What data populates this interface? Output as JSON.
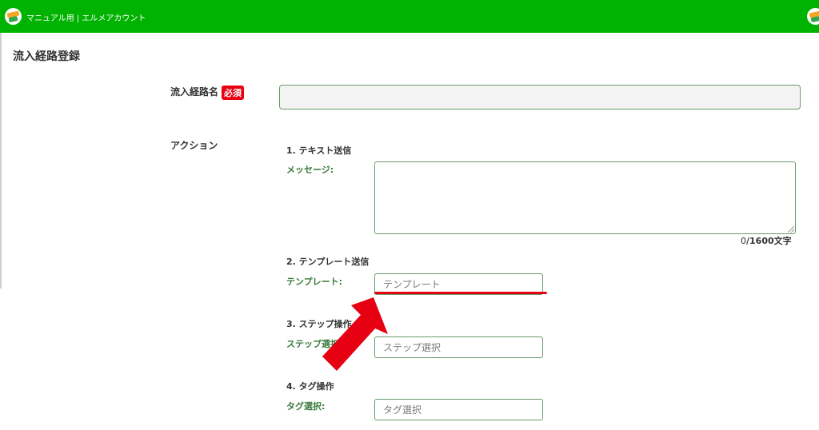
{
  "header": {
    "account_name": "マニュアル用 | エルメアカウント",
    "logo_icon": "lmessage-logo-icon",
    "bar_color": "#00b300"
  },
  "page": {
    "title": "流入経路登録"
  },
  "form": {
    "name_field": {
      "label": "流入経路名",
      "required_badge": "必須",
      "value": "",
      "placeholder": ""
    },
    "action_label": "アクション",
    "sections": {
      "text": {
        "title": "1. テキスト送信",
        "sub_label": "メッセージ:",
        "value": "",
        "counter_current": "0",
        "counter_suffix": "/1600文字"
      },
      "template": {
        "title": "2. テンプレート送信",
        "sub_label": "テンプレート:",
        "placeholder": "テンプレート"
      },
      "step": {
        "title": "3. ステップ操作",
        "sub_label": "ステップ選択:",
        "placeholder": "ステップ選択"
      },
      "tag": {
        "title": "4. タグ操作",
        "sub_label": "タグ選択:",
        "placeholder": "タグ選択"
      }
    }
  },
  "annotation": {
    "color": "#e60012",
    "arrow_icon": "red-arrow-icon"
  }
}
